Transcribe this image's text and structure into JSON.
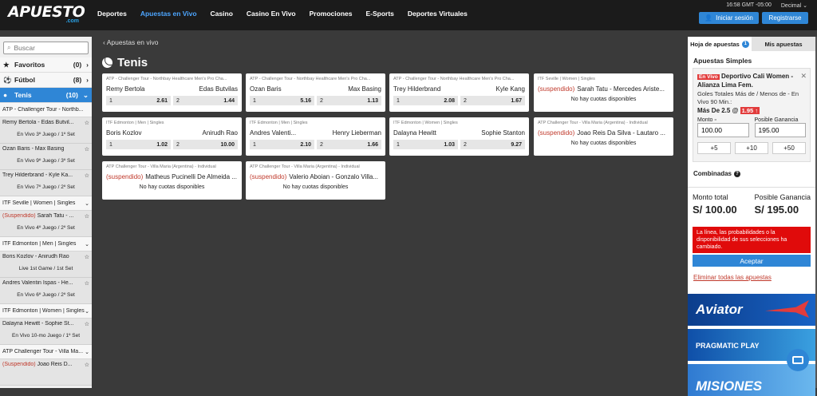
{
  "header": {
    "logo": "APUESTO",
    "logo_sub": ".com",
    "nav": [
      "Deportes",
      "Apuestas en Vivo",
      "Casino",
      "Casino En Vivo",
      "Promociones",
      "E-Sports",
      "Deportes Virtuales"
    ],
    "time": "16:58 GMT -05:00",
    "odds_format": "Decimal",
    "login": "Iniciar sesión",
    "register": "Registrarse"
  },
  "sidebar": {
    "search_placeholder": "Buscar",
    "categories": [
      {
        "name": "Favoritos",
        "count": "(0)"
      },
      {
        "name": "Fútbol",
        "count": "(8)"
      },
      {
        "name": "Tenis",
        "count": "(10)"
      }
    ],
    "groups": [
      {
        "tour": "ATP - Challenger Tour - Northb...",
        "event": null
      },
      {
        "tour": null,
        "event": "Remy Bertola - Edas Butvil...",
        "status": "En Vivo 3º Juego / 1º Set"
      },
      {
        "tour": null,
        "event": "Ozan Baris - Max Basing",
        "status": "En Vivo 9º Juego / 3º Set"
      },
      {
        "tour": null,
        "event": "Trey Hilderbrand - Kyle Ka...",
        "status": "En Vivo 7º Juego / 2º Set"
      },
      {
        "tour": "ITF Seville | Women | Singles",
        "event": null
      },
      {
        "tour": null,
        "event": "Sarah Tatu - ...",
        "suspended": "(Suspendido)",
        "status": "En Vivo 4º Juego / 2º Set"
      },
      {
        "tour": "ITF Edmonton | Men | Singles",
        "event": null
      },
      {
        "tour": null,
        "event": "Boris Kozlov - Anirudh Rao",
        "status": "Live 1st Game / 1st Set"
      },
      {
        "tour": null,
        "event": "Andres Valentin Ispas - He...",
        "status": "En Vivo 6º Juego / 2º Set"
      },
      {
        "tour": "ITF Edmonton | Women | Singles",
        "event": null
      },
      {
        "tour": null,
        "event": "Dalayna Hewitt - Sophie St...",
        "status": "En Vivo 10-mo Juego / 1º Set"
      },
      {
        "tour": "ATP Challenger Tour - Villa Ma...",
        "event": null
      },
      {
        "tour": null,
        "event": "Joao Reis D...",
        "suspended": "(Suspendido)",
        "status": ""
      }
    ]
  },
  "main": {
    "back": "Apuestas en vivo",
    "title": "Tenis",
    "cards": [
      {
        "tour": "ATP - Challenger Tour - Northbay Healthcare Men's Pro Cha...",
        "p1": "Remy Bertola",
        "p2": "Edas Butvilas",
        "o1": "2.61",
        "o2": "1.44"
      },
      {
        "tour": "ATP - Challenger Tour - Northbay Healthcare Men's Pro Cha...",
        "p1": "Ozan Baris",
        "p2": "Max Basing",
        "o1": "5.16",
        "o2": "1.13"
      },
      {
        "tour": "ATP - Challenger Tour - Northbay Healthcare Men's Pro Cha...",
        "p1": "Trey Hilderbrand",
        "p2": "Kyle Kang",
        "o1": "2.08",
        "o2": "1.67"
      },
      {
        "tour": "ITF Seville | Women | Singles",
        "susp": "(suspendido)",
        "match": "Sarah Tatu - Mercedes Ariste...",
        "nc": "No hay cuotas disponibles"
      },
      {
        "tour": "ITF Edmonton | Men | Singles",
        "p1": "Boris Kozlov",
        "p2": "Anirudh Rao",
        "o1": "1.02",
        "o2": "10.00"
      },
      {
        "tour": "ITF Edmonton | Men | Singles",
        "p1": "Andres Valenti...",
        "p2": "Henry Lieberman",
        "o1": "2.10",
        "o2": "1.66"
      },
      {
        "tour": "ITF Edmonton | Women | Singles",
        "p1": "Dalayna Hewitt",
        "p2": "Sophie Stanton",
        "o1": "1.03",
        "o2": "9.27"
      },
      {
        "tour": "ATP Challenger Tour - Villa Maria (Argentina) - Individual",
        "susp": "(suspendido)",
        "match": "Joao Reis Da Silva - Lautaro ...",
        "nc": "No hay cuotas disponibles"
      },
      {
        "tour": "ATP Challenger Tour - Villa Maria (Argentina) - Individual",
        "susp": "(suspendido)",
        "match": "Matheus Pucinelli De Almeida ...",
        "nc": "No hay cuotas disponibles"
      },
      {
        "tour": "ATP Challenger Tour - Villa Maria (Argentina) - Individual",
        "susp": "(suspendido)",
        "match": "Valerio Aboian - Gonzalo Villa...",
        "nc": "No hay cuotas disponibles"
      }
    ],
    "label_1": "1",
    "label_2": "2"
  },
  "betslip": {
    "tab1": "Hoja de apuestas",
    "tab1_badge": "1",
    "tab2": "Mis apuestas",
    "singles": "Apuestas Simples",
    "live": "En Vivo",
    "event": "Deportivo Cali Women - Alianza Lima Fem.",
    "market": "Goles Totales Más de / Menos de - En Vivo 90 Min.:",
    "selection": "Más De 2.5 @",
    "odd": "1.95",
    "stake_label": "Monto",
    "gain_label": "Posible Ganancia",
    "stake": "100.00",
    "gain": "195.00",
    "quick": [
      "+5",
      "+10",
      "+50"
    ],
    "combined": "Combinadas",
    "total_label": "Monto total",
    "total": "S/ 100.00",
    "pg_label": "Posible Ganancia",
    "pg": "S/ 195.00",
    "error": "La línea, las probabilidades o la disponibilidad de sus selecciones ha cambiado.",
    "accept": "Aceptar",
    "clear": "Eliminar todas las apuestas"
  },
  "banners": [
    "Aviator",
    "PRAGMATIC PLAY",
    "MISIONES"
  ]
}
